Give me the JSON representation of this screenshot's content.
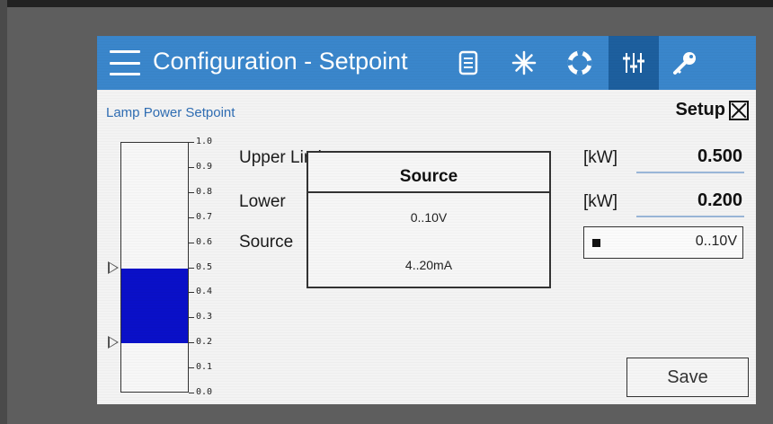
{
  "header": {
    "title": "Configuration - Setpoint",
    "icons": [
      "menu-icon",
      "list-icon",
      "star-icon",
      "lifebuoy-icon",
      "sliders-icon",
      "key-icon"
    ],
    "accent_color": "#3a86cb",
    "active_color": "#1d5f9e"
  },
  "section": {
    "title": "Lamp Power Setpoint",
    "setup_label": "Setup"
  },
  "gauge": {
    "scale": [
      "1.0",
      "0.9",
      "0.8",
      "0.7",
      "0.6",
      "0.5",
      "0.4",
      "0.3",
      "0.2",
      "0.1",
      "0.0"
    ],
    "upper_fraction": 0.5,
    "lower_fraction": 0.2,
    "fill_color": "#0a10c8"
  },
  "rows": {
    "upper_label": "Upper Limit",
    "lower_label": "Lower",
    "source_label": "Source",
    "upper_unit": "[kW]",
    "lower_unit": "[kW]",
    "upper_value": "0.500",
    "lower_value": "0.200",
    "source_value": "0..10V"
  },
  "popup": {
    "title": "Source",
    "options": [
      "0..10V",
      "4..20mA"
    ]
  },
  "buttons": {
    "save": "Save"
  }
}
